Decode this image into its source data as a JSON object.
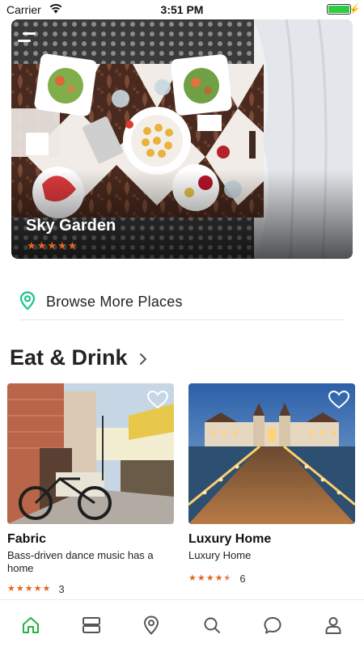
{
  "status_bar": {
    "carrier": "Carrier",
    "time": "3:51 PM",
    "battery_level": 1.0,
    "battery_color": "#2ecc40"
  },
  "hero": {
    "title": "Sky Garden",
    "rating": 5,
    "star_color": "#e8641b"
  },
  "browse": {
    "label": "Browse More Places",
    "icon": "map-pin-icon",
    "icon_color": "#19c38b"
  },
  "section": {
    "title": "Eat & Drink"
  },
  "cards": [
    {
      "title": "Fabric",
      "subtitle": "Bass-driven dance music has a home",
      "rating": 5,
      "review_count": "3",
      "favorited": false
    },
    {
      "title": "Luxury Home",
      "subtitle": "Luxury Home",
      "rating": 4.5,
      "review_count": "6",
      "favorited": false
    }
  ],
  "tab_bar": {
    "active_color": "#27b33c",
    "inactive_color": "#555555",
    "tabs": [
      {
        "icon": "home-icon",
        "active": true
      },
      {
        "icon": "list-icon",
        "active": false
      },
      {
        "icon": "map-pin-icon",
        "active": false
      },
      {
        "icon": "search-icon",
        "active": false
      },
      {
        "icon": "chat-icon",
        "active": false
      },
      {
        "icon": "profile-icon",
        "active": false
      }
    ]
  }
}
